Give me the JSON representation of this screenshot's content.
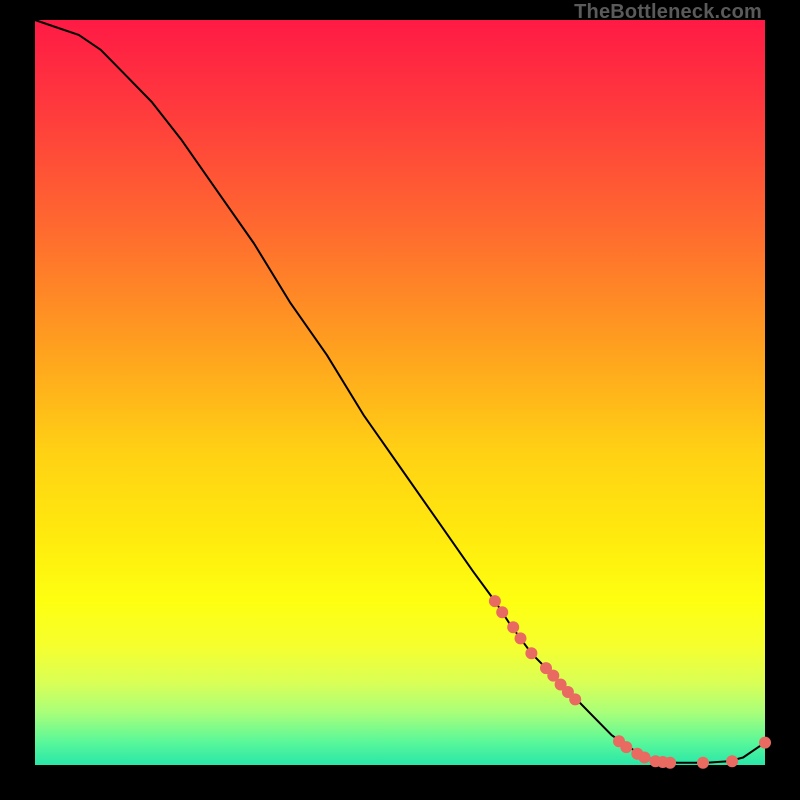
{
  "watermark": "TheBottleneck.com",
  "chart_data": {
    "type": "line",
    "title": "",
    "xlabel": "",
    "ylabel": "",
    "xlim": [
      0,
      100
    ],
    "ylim": [
      0,
      100
    ],
    "grid": false,
    "legend": false,
    "series": [
      {
        "name": "curve",
        "color": "#000000",
        "x": [
          0,
          3,
          6,
          9,
          12,
          16,
          20,
          25,
          30,
          35,
          40,
          45,
          50,
          55,
          60,
          63,
          65,
          68,
          70,
          73,
          76,
          79,
          82,
          85,
          88,
          92,
          95,
          97,
          100
        ],
        "values": [
          100,
          99,
          98,
          96,
          93,
          89,
          84,
          77,
          70,
          62,
          55,
          47,
          40,
          33,
          26,
          22,
          19,
          15,
          13,
          10,
          7,
          4,
          2,
          0.5,
          0.3,
          0.3,
          0.5,
          1.0,
          3.0
        ]
      }
    ],
    "markers": [
      {
        "x": 63.0,
        "y": 22.0
      },
      {
        "x": 64.0,
        "y": 20.5
      },
      {
        "x": 65.5,
        "y": 18.5
      },
      {
        "x": 66.5,
        "y": 17.0
      },
      {
        "x": 68.0,
        "y": 15.0
      },
      {
        "x": 70.0,
        "y": 13.0
      },
      {
        "x": 71.0,
        "y": 12.0
      },
      {
        "x": 72.0,
        "y": 10.8
      },
      {
        "x": 73.0,
        "y": 9.8
      },
      {
        "x": 74.0,
        "y": 8.8
      },
      {
        "x": 80.0,
        "y": 3.2
      },
      {
        "x": 81.0,
        "y": 2.4
      },
      {
        "x": 82.5,
        "y": 1.5
      },
      {
        "x": 83.5,
        "y": 1.0
      },
      {
        "x": 85.0,
        "y": 0.5
      },
      {
        "x": 86.0,
        "y": 0.4
      },
      {
        "x": 87.0,
        "y": 0.3
      },
      {
        "x": 91.5,
        "y": 0.3
      },
      {
        "x": 95.5,
        "y": 0.5
      },
      {
        "x": 100.0,
        "y": 3.0
      }
    ],
    "marker_style": {
      "color": "#e96a61",
      "radius_px": 6
    }
  }
}
